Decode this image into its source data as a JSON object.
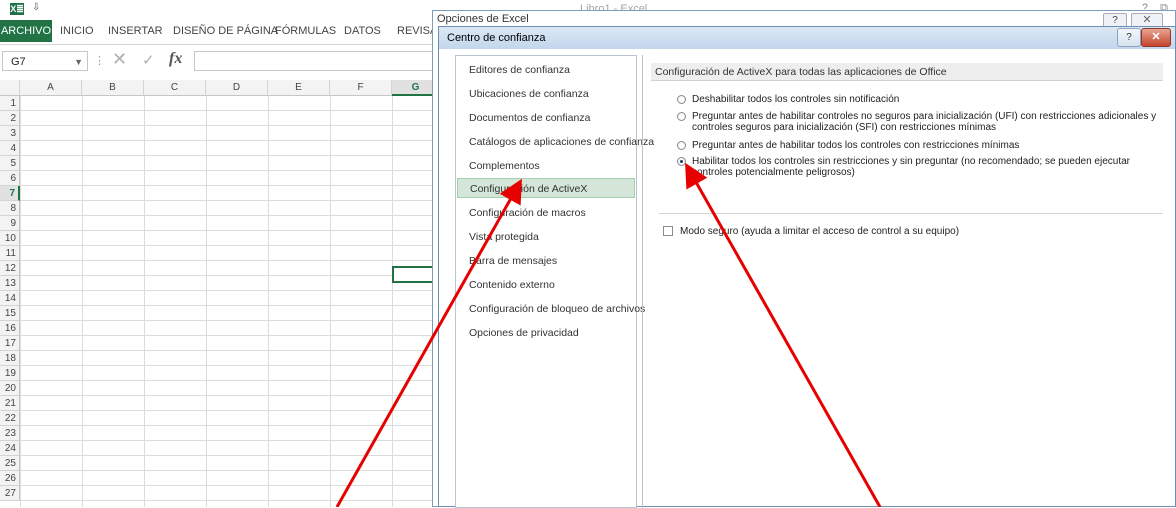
{
  "excel": {
    "logo_text": "X≣",
    "quick_access": "⇩",
    "window_title": "Libro1 - Excel",
    "help": "?",
    "restore": "⧉",
    "ribbon_tabs": [
      "ARCHIVO",
      "INICIO",
      "INSERTAR",
      "DISEÑO DE PÁGINA",
      "FÓRMULAS",
      "DATOS",
      "REVISAR"
    ],
    "name_box": "G7",
    "name_box_dropdown": "▼",
    "formula_separator": "⋮",
    "cancel_glyph": "✕",
    "enter_glyph": "✓",
    "fx_label": "fx",
    "formula_value": "",
    "columns": [
      "A",
      "B",
      "C",
      "D",
      "E",
      "F",
      "G"
    ],
    "selected_column": "G",
    "rows": [
      "1",
      "2",
      "3",
      "4",
      "5",
      "6",
      "7",
      "8",
      "9",
      "10",
      "11",
      "12",
      "13",
      "14",
      "15",
      "16",
      "17",
      "18",
      "19",
      "20",
      "21",
      "22",
      "23",
      "24",
      "25",
      "26",
      "27"
    ],
    "selected_row": "7"
  },
  "outer_dialog": {
    "title": "Opciones de Excel",
    "help": "?",
    "close": "✕"
  },
  "trust_center": {
    "title": "Centro de confianza",
    "help_button": "?",
    "close_button": "✕",
    "nav_items": [
      "Editores de confianza",
      "Ubicaciones de confianza",
      "Documentos de confianza",
      "Catálogos de aplicaciones de confianza",
      "Complementos",
      "Configuración de ActiveX",
      "Configuración de macros",
      "Vista protegida",
      "Barra de mensajes",
      "Contenido externo",
      "Configuración de bloqueo de archivos",
      "Opciones de privacidad"
    ],
    "selected_nav": "Configuración de ActiveX",
    "section_header": "Configuración de ActiveX para todas las aplicaciones de Office",
    "options": [
      {
        "label": "Deshabilitar todos los controles sin notificación",
        "selected": false
      },
      {
        "label": "Preguntar antes de habilitar controles no seguros para inicialización (UFI) con restricciones adicionales y controles seguros para inicialización (SFI) con restricciones mínimas",
        "selected": false
      },
      {
        "label": "Preguntar antes de habilitar todos los controles con restricciones mínimas",
        "selected": false
      },
      {
        "label": "Habilitar todos los controles sin restricciones y sin preguntar (no recomendado; se pueden ejecutar controles potencialmente peligrosos)",
        "selected": true
      }
    ],
    "safe_mode_label": "Modo seguro (ayuda a limitar el acceso de control a su equipo)",
    "safe_mode_checked": false
  },
  "annotation_color": "#e60000"
}
